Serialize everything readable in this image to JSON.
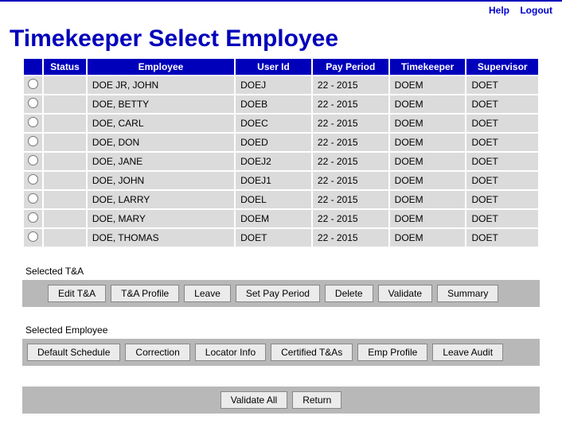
{
  "topnav": {
    "help": "Help",
    "logout": "Logout"
  },
  "page_title": "Timekeeper Select Employee",
  "table": {
    "headers": {
      "select": "",
      "status": "Status",
      "employee": "Employee",
      "user_id": "User Id",
      "pay_period": "Pay Period",
      "timekeeper": "Timekeeper",
      "supervisor": "Supervisor"
    },
    "rows": [
      {
        "status": "",
        "employee": "DOE JR, JOHN",
        "user_id": "DOEJ",
        "pay_period": "22 - 2015",
        "timekeeper": "DOEM",
        "supervisor": "DOET"
      },
      {
        "status": "",
        "employee": "DOE, BETTY",
        "user_id": "DOEB",
        "pay_period": "22 - 2015",
        "timekeeper": "DOEM",
        "supervisor": "DOET"
      },
      {
        "status": "",
        "employee": "DOE, CARL",
        "user_id": "DOEC",
        "pay_period": "22 - 2015",
        "timekeeper": "DOEM",
        "supervisor": "DOET"
      },
      {
        "status": "",
        "employee": "DOE, DON",
        "user_id": "DOED",
        "pay_period": "22 - 2015",
        "timekeeper": "DOEM",
        "supervisor": "DOET"
      },
      {
        "status": "",
        "employee": "DOE, JANE",
        "user_id": "DOEJ2",
        "pay_period": "22 - 2015",
        "timekeeper": "DOEM",
        "supervisor": "DOET"
      },
      {
        "status": "",
        "employee": "DOE, JOHN",
        "user_id": "DOEJ1",
        "pay_period": "22 - 2015",
        "timekeeper": "DOEM",
        "supervisor": "DOET"
      },
      {
        "status": "",
        "employee": "DOE, LARRY",
        "user_id": "DOEL",
        "pay_period": "22 - 2015",
        "timekeeper": "DOEM",
        "supervisor": "DOET"
      },
      {
        "status": "",
        "employee": "DOE, MARY",
        "user_id": "DOEM",
        "pay_period": "22 - 2015",
        "timekeeper": "DOEM",
        "supervisor": "DOET"
      },
      {
        "status": "",
        "employee": "DOE, THOMAS",
        "user_id": "DOET",
        "pay_period": "22 - 2015",
        "timekeeper": "DOEM",
        "supervisor": "DOET"
      }
    ]
  },
  "sections": {
    "selected_ta": {
      "label": "Selected T&A",
      "buttons": {
        "edit_ta": "Edit T&A",
        "ta_profile": "T&A Profile",
        "leave": "Leave",
        "set_pay_period": "Set Pay Period",
        "delete": "Delete",
        "validate": "Validate",
        "summary": "Summary"
      }
    },
    "selected_employee": {
      "label": "Selected Employee",
      "buttons": {
        "default_schedule": "Default Schedule",
        "correction": "Correction",
        "locator_info": "Locator Info",
        "certified_tas": "Certified T&As",
        "emp_profile": "Emp Profile",
        "leave_audit": "Leave Audit"
      }
    },
    "footer": {
      "buttons": {
        "validate_all": "Validate All",
        "return": "Return"
      }
    }
  }
}
